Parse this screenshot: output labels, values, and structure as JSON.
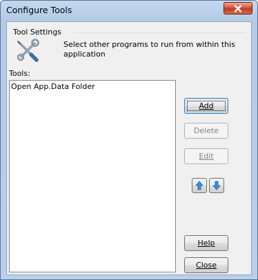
{
  "window": {
    "title": "Configure Tools"
  },
  "group": {
    "legend": "Tool Settings",
    "description": "Select other programs to run from within this application",
    "icon": "tools-icon"
  },
  "tools": {
    "label": "Tools:",
    "items": [
      "Open App.Data Folder"
    ]
  },
  "buttons": {
    "add": {
      "label": "Add",
      "state": "default"
    },
    "delete": {
      "label": "Delete",
      "state": "disabled"
    },
    "edit": {
      "label": "Edit",
      "state": "disabled"
    },
    "move_up": {
      "icon": "arrow-up-icon"
    },
    "move_down": {
      "icon": "arrow-down-icon"
    },
    "help": {
      "label": "Help"
    },
    "close": {
      "label": "Close"
    }
  },
  "colors": {
    "title_close_button": "#c9452a",
    "arrow_blue": "#2f7fd8"
  }
}
